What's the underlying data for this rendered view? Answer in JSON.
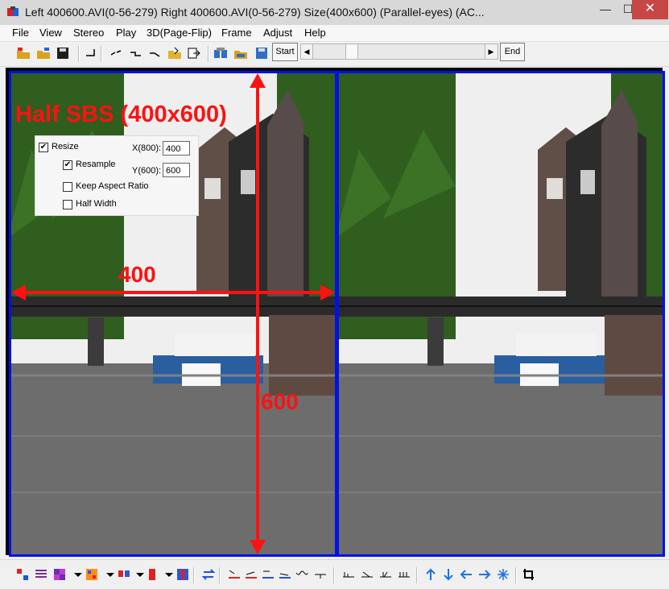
{
  "window": {
    "title": "Left 400600.AVI(0-56-279) Right 400600.AVI(0-56-279) Size(400x600)  (Parallel-eyes) (AC...",
    "minimize": "—",
    "maximize": "☐",
    "close": "✕"
  },
  "menu": {
    "items": [
      "File",
      "View",
      "Stereo",
      "Play",
      "3D(Page-Flip)",
      "Frame",
      "Adjust",
      "Help"
    ]
  },
  "toolbar": {
    "start_label": "Start",
    "end_label": "End",
    "scroll_left": "◀",
    "scroll_right": "▶"
  },
  "overlay": {
    "title": "Half SBS (400x600)",
    "width_label": "400",
    "height_label": "600"
  },
  "resize_panel": {
    "resize_label": "Resize",
    "resample_label": "Resample",
    "keep_aspect_label": "Keep Aspect Ratio",
    "half_width_label": "Half Width",
    "x_label": "X(800):",
    "y_label": "Y(600):",
    "x_value": "400",
    "y_value": "600",
    "resize_checked": true,
    "resample_checked": true,
    "keep_aspect_checked": false,
    "half_width_checked": false
  },
  "colors": {
    "overlay_red": "#ff1111",
    "pane_border_blue": "#0011e9"
  }
}
